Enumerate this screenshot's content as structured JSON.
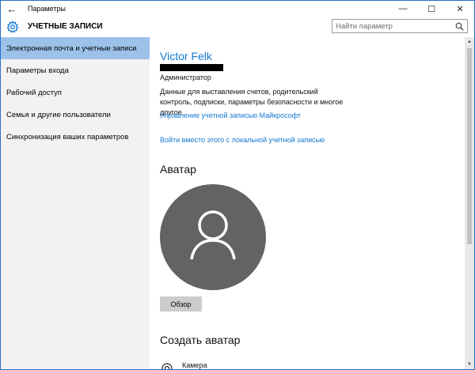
{
  "window": {
    "title": "Параметры",
    "back_glyph": "←",
    "minimize_glyph": "—",
    "maximize_glyph": "☐",
    "close_glyph": "✕"
  },
  "header": {
    "title": "УЧЕТНЫЕ ЗАПИСИ",
    "search_placeholder": "Найти параметр",
    "search_value": ""
  },
  "sidebar": {
    "items": [
      {
        "label": "Электронная почта и учетные записи",
        "active": true
      },
      {
        "label": "Параметры входа",
        "active": false
      },
      {
        "label": "Рабочий доступ",
        "active": false
      },
      {
        "label": "Семья и другие пользователи",
        "active": false
      },
      {
        "label": "Синхронизация ваших параметров",
        "active": false
      }
    ]
  },
  "account": {
    "name": "Victor Felk",
    "role": "Администратор",
    "description": "Данные для выставления счетов, родительский контроль, подписки, параметры безопасности и многое другое",
    "manage_link": "Управление учетной записью Майкрософт",
    "local_link": "Войти вместо этого с локальной учетной записью"
  },
  "avatar_section": {
    "title": "Аватар",
    "browse_button": "Обзор"
  },
  "create_section": {
    "title": "Создать аватар",
    "camera_label": "Камера"
  },
  "colors": {
    "accent": "#1378d1",
    "sidebar_bg": "#f2f2f2",
    "selected_bg": "#9cc2ea",
    "avatar_bg": "#636363"
  }
}
